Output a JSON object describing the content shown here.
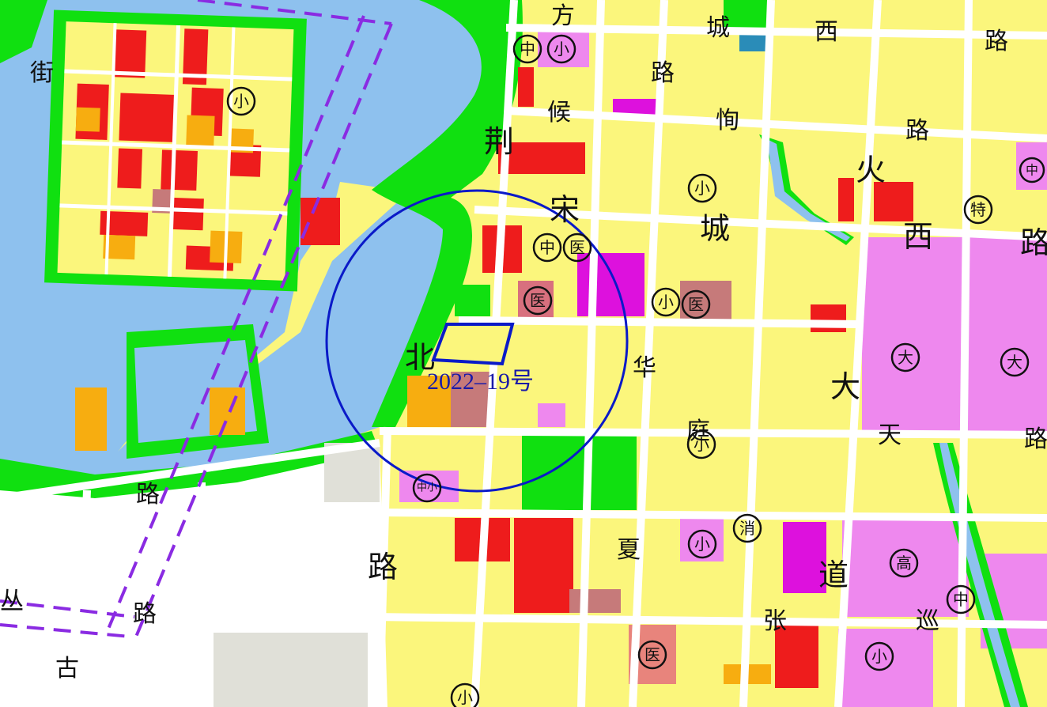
{
  "colors": {
    "water": "#8ec1ee",
    "green": "#10e010",
    "residential": "#fbf67c",
    "commercial": "#ee1c1c",
    "mixed": "#f7ad10",
    "education": "#ee88ee",
    "magenta": "#dd11dd",
    "medical": "#d8707e",
    "road": "#ffffff",
    "undeveloped": "#ffffff",
    "highlight": "#0a1ac8",
    "rail": "#8a2be2"
  },
  "road_labels": [
    {
      "id": "jie",
      "text": "街"
    },
    {
      "id": "fang",
      "text": "方"
    },
    {
      "id": "cheng",
      "text": "城"
    },
    {
      "id": "xi1",
      "text": "西"
    },
    {
      "id": "lu1",
      "text": "路"
    },
    {
      "id": "lu2",
      "text": "路"
    },
    {
      "id": "hou",
      "text": "候"
    },
    {
      "id": "xun",
      "text": "恂"
    },
    {
      "id": "lu3",
      "text": "路"
    },
    {
      "id": "jing",
      "text": "荆"
    },
    {
      "id": "huo",
      "text": "火"
    },
    {
      "id": "song",
      "text": "宋"
    },
    {
      "id": "cheng2",
      "text": "城"
    },
    {
      "id": "xi2",
      "text": "西"
    },
    {
      "id": "lu4",
      "text": "路"
    },
    {
      "id": "bei",
      "text": "北"
    },
    {
      "id": "hua",
      "text": "华"
    },
    {
      "id": "da",
      "text": "大"
    },
    {
      "id": "tian",
      "text": "天"
    },
    {
      "id": "lu5",
      "text": "路"
    },
    {
      "id": "lu6",
      "text": "路"
    },
    {
      "id": "ting",
      "text": "庭"
    },
    {
      "id": "lu7",
      "text": "路"
    },
    {
      "id": "xia",
      "text": "夏"
    },
    {
      "id": "dao",
      "text": "道"
    },
    {
      "id": "lu8",
      "text": "路"
    },
    {
      "id": "zhang",
      "text": "张"
    },
    {
      "id": "xun2",
      "text": "巡"
    },
    {
      "id": "gu",
      "text": "古"
    },
    {
      "id": "zuo",
      "text": "丛"
    }
  ],
  "facility_symbols": [
    {
      "id": "s1",
      "text": "中"
    },
    {
      "id": "s2",
      "text": "小"
    },
    {
      "id": "s3",
      "text": "小"
    },
    {
      "id": "s4",
      "text": "中"
    },
    {
      "id": "s5",
      "text": "小"
    },
    {
      "id": "s6",
      "text": "特"
    },
    {
      "id": "s7",
      "text": "中"
    },
    {
      "id": "s8",
      "text": "医"
    },
    {
      "id": "s9",
      "text": "医"
    },
    {
      "id": "s10",
      "text": "小"
    },
    {
      "id": "s11",
      "text": "医"
    },
    {
      "id": "s12",
      "text": "大"
    },
    {
      "id": "s13",
      "text": "大"
    },
    {
      "id": "s14",
      "text": "小"
    },
    {
      "id": "s15",
      "text": "中小"
    },
    {
      "id": "s16",
      "text": "消"
    },
    {
      "id": "s17",
      "text": "小"
    },
    {
      "id": "s18",
      "text": "高"
    },
    {
      "id": "s19",
      "text": "中"
    },
    {
      "id": "s20",
      "text": "医"
    },
    {
      "id": "s21",
      "text": "小"
    },
    {
      "id": "s22",
      "text": "小"
    }
  ],
  "plot_label": "2022–19号"
}
